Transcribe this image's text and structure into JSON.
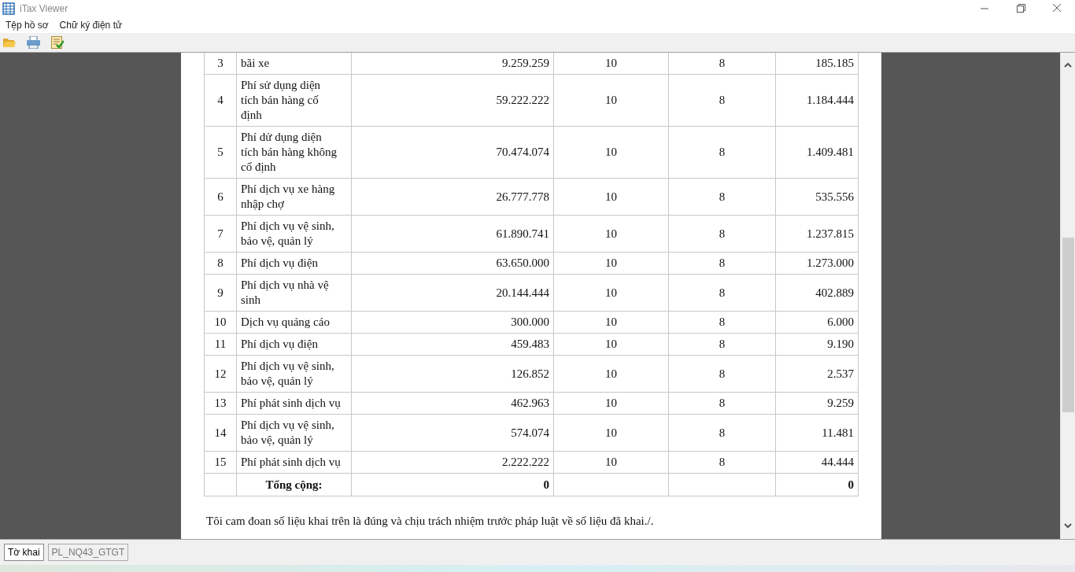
{
  "window": {
    "title": "iTax Viewer"
  },
  "menu": [
    {
      "label": "Tệp hồ sơ"
    },
    {
      "label": "Chữ ký điện tử"
    }
  ],
  "rows": [
    {
      "no": "3",
      "name": [
        "bãi xe"
      ],
      "amount": "9.259.259",
      "rate": "10",
      "pct": "8",
      "tax": "185.185"
    },
    {
      "no": "4",
      "name": [
        "Phí sử dụng diện",
        "tích bán hàng cố",
        "định"
      ],
      "amount": "59.222.222",
      "rate": "10",
      "pct": "8",
      "tax": "1.184.444"
    },
    {
      "no": "5",
      "name": [
        "Phí dử dụng diện",
        "tích bán hàng không",
        "cố định"
      ],
      "amount": "70.474.074",
      "rate": "10",
      "pct": "8",
      "tax": "1.409.481"
    },
    {
      "no": "6",
      "name": [
        "Phí dịch vụ xe hàng",
        "nhập chợ"
      ],
      "amount": "26.777.778",
      "rate": "10",
      "pct": "8",
      "tax": "535.556"
    },
    {
      "no": "7",
      "name": [
        "Phí dịch vụ vệ sinh,",
        "bảo vệ, quản lý"
      ],
      "amount": "61.890.741",
      "rate": "10",
      "pct": "8",
      "tax": "1.237.815"
    },
    {
      "no": "8",
      "name": [
        "Phí dịch vụ điện"
      ],
      "amount": "63.650.000",
      "rate": "10",
      "pct": "8",
      "tax": "1.273.000"
    },
    {
      "no": "9",
      "name": [
        "Phí dịch vụ nhà vệ",
        "sinh"
      ],
      "amount": "20.144.444",
      "rate": "10",
      "pct": "8",
      "tax": "402.889"
    },
    {
      "no": "10",
      "name": [
        "Dịch vụ quảng cáo"
      ],
      "amount": "300.000",
      "rate": "10",
      "pct": "8",
      "tax": "6.000"
    },
    {
      "no": "11",
      "name": [
        "Phí dịch vụ điện"
      ],
      "amount": "459.483",
      "rate": "10",
      "pct": "8",
      "tax": "9.190"
    },
    {
      "no": "12",
      "name": [
        "Phí dịch vụ vệ sinh,",
        "bảo vệ, quản lý"
      ],
      "amount": "126.852",
      "rate": "10",
      "pct": "8",
      "tax": "2.537"
    },
    {
      "no": "13",
      "name": [
        "Phí phát sinh dịch vụ"
      ],
      "amount": "462.963",
      "rate": "10",
      "pct": "8",
      "tax": "9.259"
    },
    {
      "no": "14",
      "name": [
        "Phí dịch vụ vệ sinh,",
        "bảo vệ, quản lý"
      ],
      "amount": "574.074",
      "rate": "10",
      "pct": "8",
      "tax": "11.481"
    },
    {
      "no": "15",
      "name": [
        "Phí phát sinh dịch vụ"
      ],
      "amount": "2.222.222",
      "rate": "10",
      "pct": "8",
      "tax": "44.444"
    }
  ],
  "total": {
    "label": "Tổng cộng:",
    "amount": "0",
    "tax": "0"
  },
  "declaration": "Tôi cam đoan số liệu khai trên là đúng và chịu trách nhiệm trước pháp luật về số liệu đã khai./.",
  "tabs": [
    {
      "label": "Tờ khai",
      "selected": true
    },
    {
      "label": "PL_NQ43_GTGT",
      "selected": false
    }
  ]
}
